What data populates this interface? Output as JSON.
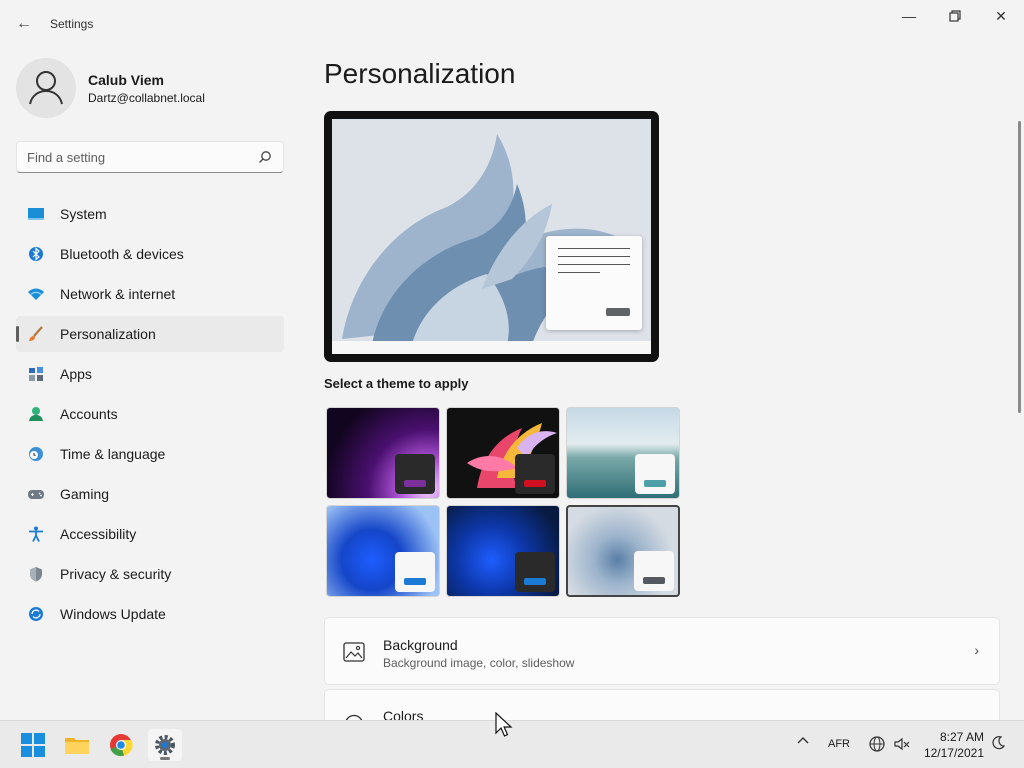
{
  "window": {
    "title": "Settings",
    "back_icon": "back-arrow-icon"
  },
  "user": {
    "name": "Calub Viem",
    "email": "Dartz@collabnet.local"
  },
  "search": {
    "placeholder": "Find a setting"
  },
  "sidebar": {
    "items": [
      {
        "label": "System",
        "icon": "system-icon",
        "active": false
      },
      {
        "label": "Bluetooth & devices",
        "icon": "bluetooth-icon",
        "active": false
      },
      {
        "label": "Network & internet",
        "icon": "wifi-icon",
        "active": false
      },
      {
        "label": "Personalization",
        "icon": "brush-icon",
        "active": true
      },
      {
        "label": "Apps",
        "icon": "apps-icon",
        "active": false
      },
      {
        "label": "Accounts",
        "icon": "accounts-icon",
        "active": false
      },
      {
        "label": "Time & language",
        "icon": "clock-globe-icon",
        "active": false
      },
      {
        "label": "Gaming",
        "icon": "gamepad-icon",
        "active": false
      },
      {
        "label": "Accessibility",
        "icon": "accessibility-icon",
        "active": false
      },
      {
        "label": "Privacy & security",
        "icon": "shield-icon",
        "active": false
      },
      {
        "label": "Windows Update",
        "icon": "update-icon",
        "active": false
      }
    ]
  },
  "main": {
    "title": "Personalization",
    "themes_heading": "Select a theme to apply",
    "themes": [
      {
        "name": "glow",
        "accent": "#7a2f9a",
        "selected": false
      },
      {
        "name": "captured-motion",
        "accent": "#d01020",
        "selected": false
      },
      {
        "name": "sunrise",
        "accent": "#4f9fa8",
        "selected": false
      },
      {
        "name": "windows-light",
        "accent": "#1a7ad4",
        "selected": false
      },
      {
        "name": "windows-dark",
        "accent": "#1a7ad4",
        "selected": false
      },
      {
        "name": "flow",
        "accent": "#555a60",
        "selected": true
      }
    ],
    "cards": [
      {
        "title": "Background",
        "subtitle": "Background image, color, slideshow",
        "icon": "image-icon"
      },
      {
        "title": "Colors",
        "subtitle": "",
        "icon": "palette-icon"
      }
    ]
  },
  "taskbar": {
    "apps": [
      "start-icon",
      "file-explorer-icon",
      "chrome-icon",
      "settings-icon"
    ],
    "language": "AFR",
    "time": "8:27 AM",
    "date": "12/17/2021"
  }
}
